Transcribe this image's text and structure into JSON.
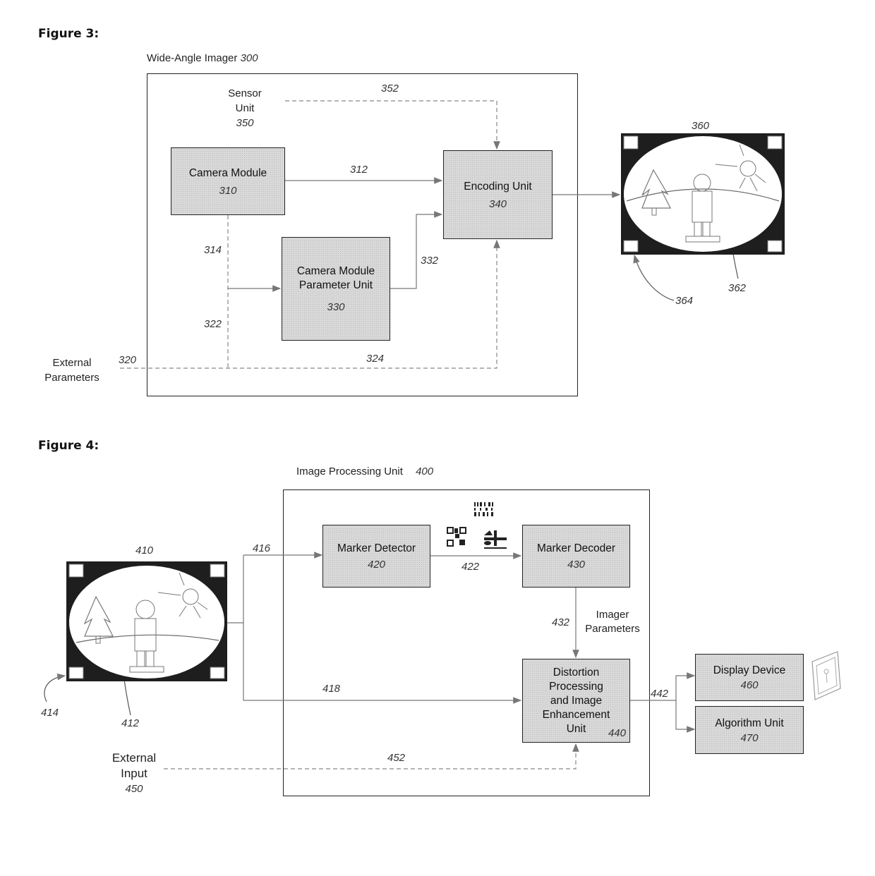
{
  "figure3": {
    "title": "Figure 3:",
    "container": {
      "label": "Wide-Angle Imager",
      "ref": "300"
    },
    "sensor_unit": {
      "label_line1": "Sensor",
      "label_line2": "Unit",
      "ref": "350"
    },
    "camera_module": {
      "label": "Camera Module",
      "ref": "310"
    },
    "camera_param_unit": {
      "label_line1": "Camera Module",
      "label_line2": "Parameter Unit",
      "ref": "330"
    },
    "encoding_unit": {
      "label": "Encoding Unit",
      "ref": "340"
    },
    "external_parameters": {
      "label_line1": "External",
      "label_line2": "Parameters",
      "ref": "320"
    },
    "connections": {
      "c312": "312",
      "c314": "314",
      "c322": "322",
      "c324": "324",
      "c332": "332",
      "c352": "352"
    },
    "output_image": {
      "ref": "360",
      "imaged_area_ref": "362",
      "marker_ref": "364"
    }
  },
  "figure4": {
    "title": "Figure 4:",
    "container": {
      "label": "Image Processing Unit",
      "ref": "400"
    },
    "input_image": {
      "ref": "410",
      "imaged_area_ref": "412",
      "marker_ref": "414"
    },
    "marker_detector": {
      "label": "Marker Detector",
      "ref": "420"
    },
    "marker_decoder": {
      "label": "Marker Decoder",
      "ref": "430"
    },
    "distortion_unit": {
      "label_line1": "Distortion",
      "label_line2": "Processing",
      "label_line3": "and Image",
      "label_line4": "Enhancement",
      "label_line5": "Unit",
      "ref": "440"
    },
    "imager_parameters": {
      "label_line1": "Imager",
      "label_line2": "Parameters"
    },
    "display_device": {
      "label": "Display Device",
      "ref": "460"
    },
    "algorithm_unit": {
      "label": "Algorithm Unit",
      "ref": "470"
    },
    "external_input": {
      "label_line1": "External",
      "label_line2": "Input",
      "ref": "450"
    },
    "connections": {
      "c416": "416",
      "c418": "418",
      "c422": "422",
      "c432": "432",
      "c442": "442",
      "c452": "452"
    }
  },
  "icons": [
    "qr-code-icon",
    "barcode-icon",
    "marker-symbol-icon",
    "tablet-display-icon",
    "wide-angle-scene-icon"
  ]
}
